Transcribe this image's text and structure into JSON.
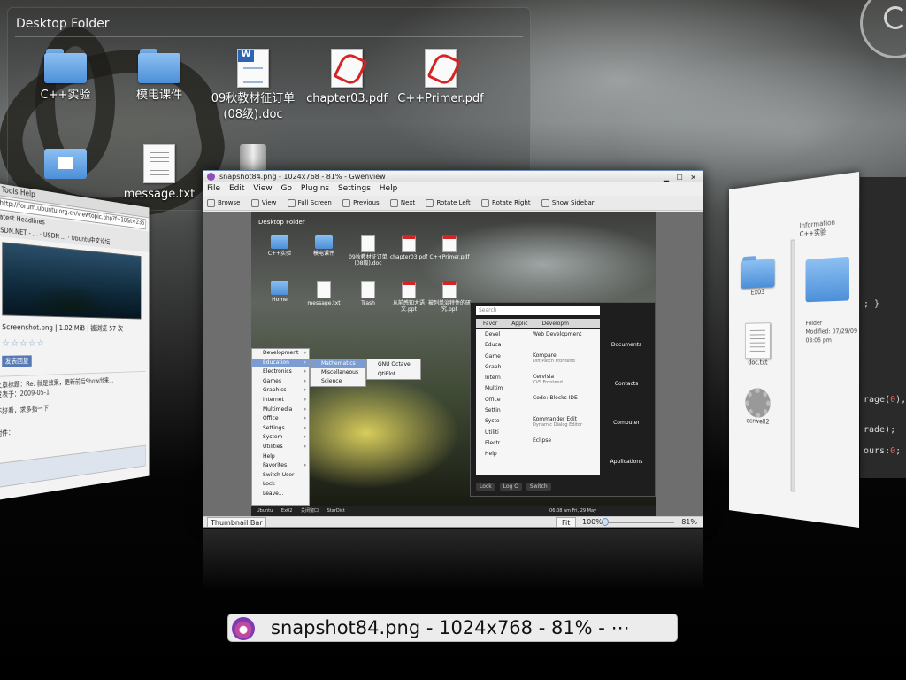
{
  "desktop_folder": {
    "title": "Desktop Folder",
    "icons": [
      {
        "label": "C++实验",
        "kind": "folder"
      },
      {
        "label": "模电课件",
        "kind": "folder"
      },
      {
        "label": "09秋教材征订单(08级).doc",
        "kind": "doc"
      },
      {
        "label": "chapter03.pdf",
        "kind": "pdf"
      },
      {
        "label": "C++Primer.pdf",
        "kind": "pdf"
      },
      {
        "label": "message.txt",
        "kind": "txt"
      }
    ]
  },
  "left_window": {
    "menu": "_ Tools Help",
    "url": "http://forum.ubuntu.org.cn/viewtopic.php?f=10&t=235",
    "tabs": "Latest Headlines",
    "tabs2": "CSDN.NET - ... · USDN ... · Ubuntu中文论坛",
    "image_caption": "Screenshot.png | 1.02 MiB | 被浏览 57 次",
    "reply_label": "发表回复",
    "post_title": "文章标题：Re: 就是效果，更新前后Show出来...",
    "post_meta": "发表于：2009-05-1",
    "post_body": "不好看，求多指一下",
    "attachments_label": "附件："
  },
  "right_window": {
    "info_title": "Information",
    "info_name": "C++实验",
    "info_type": "Folder",
    "info_modified": "Modified: 07/29/09",
    "info_time": "03:05 pm",
    "files": [
      "Ex03",
      "doc.txt",
      "ccrwell2"
    ]
  },
  "code_peek": {
    "lines": [
      {
        "text": "; }",
        "num": ""
      },
      {
        "text": "rage(",
        "num": "0",
        "tail": "),sen"
      },
      {
        "text": "rade);",
        "num": "",
        "tail": ""
      },
      {
        "text": "ours:",
        "num": "0",
        "tail": ";"
      }
    ]
  },
  "gwenview": {
    "title": "snapshot84.png - 1024x768 - 81% - Gwenview",
    "menu": [
      "File",
      "Edit",
      "View",
      "Go",
      "Plugins",
      "Settings",
      "Help"
    ],
    "toolbar": [
      "Browse",
      "View",
      "Full Screen",
      "Previous",
      "Next",
      "Rotate Left",
      "Rotate Right",
      "Show Sidebar"
    ],
    "status": {
      "thumbnail_bar": "Thumbnail Bar",
      "fit": "Fit",
      "zoom": "100%",
      "percent": "81%"
    },
    "inner": {
      "folder_title": "Desktop Folder",
      "icons_row1": [
        "C++实验",
        "模电课件",
        "09秋教材征订单(08级).doc",
        "chapter03.pdf",
        "C++Primer.pdf"
      ],
      "icons_row2": [
        "Home",
        "message.txt",
        "Trash",
        "从前感知大语文.ppt",
        "被列单治特性的研究.ppt"
      ],
      "menu1": [
        "Development",
        "Education",
        "Electronics",
        "Games",
        "Graphics",
        "Internet",
        "Multimedia",
        "Office",
        "Settings",
        "System",
        "Utilities",
        "Help",
        "Favorites",
        "Switch User",
        "Lock",
        "Leave..."
      ],
      "menu2": [
        "Mathematics",
        "Miscellaneous",
        "Science"
      ],
      "menu3": [
        "GNU Octave",
        "QtiPlot"
      ],
      "search": "Search",
      "lancelot_tabs": [
        "Favor",
        "Applic",
        "Developm"
      ],
      "lancelot_categories": [
        "Devel",
        "Educa",
        "Game",
        "Graph",
        "Intern",
        "Multim",
        "Office",
        "Settin",
        "Syste",
        "Utiliti",
        "Electr",
        "Help"
      ],
      "lancelot_apps": [
        {
          "name": "Web Development",
          "sub": ""
        },
        {
          "name": "Kompare",
          "sub": "Diff/Patch Frontend"
        },
        {
          "name": "Cervisia",
          "sub": "CVS Frontend"
        },
        {
          "name": "Code::Blocks IDE",
          "sub": ""
        },
        {
          "name": "Kommander Edit",
          "sub": "Dynamic Dialog Editor"
        },
        {
          "name": "Eclipse",
          "sub": ""
        }
      ],
      "lancelot_side": [
        "Documents",
        "Contacts",
        "Computer",
        "Applications"
      ],
      "lancelot_bottom": [
        "Lock",
        "Log O",
        "Switch"
      ],
      "taskbar": [
        "Ubuntu",
        "Ex02",
        "关闭窗口",
        "StarDict"
      ],
      "clock": "06:08 am Fri, 29 May"
    }
  },
  "caption": {
    "text": "snapshot84.png - 1024x768 - 81% - ⋯"
  }
}
